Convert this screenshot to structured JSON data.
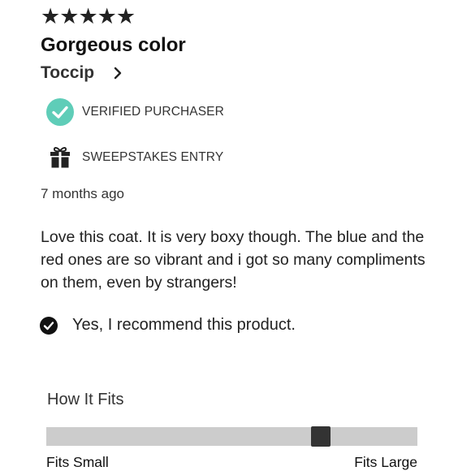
{
  "review": {
    "rating": 5,
    "rating_max": 5,
    "star_glyph": "★",
    "title": "Gorgeous color",
    "author": "Toccip",
    "badges": {
      "verified": {
        "label": "VERIFIED PURCHASER",
        "icon": "check-circle-icon",
        "color": "#5fcdb8"
      },
      "sweepstakes": {
        "label": "SWEEPSTAKES ENTRY",
        "icon": "gift-icon"
      }
    },
    "timestamp": "7 months ago",
    "body": "Love this coat. It is very boxy though. The blue and the red ones are so vibrant and i got so many compliments on them, even by strangers!",
    "recommend": {
      "text": "Yes, I recommend this product.",
      "icon": "check-circle-filled-icon"
    }
  },
  "fit": {
    "title": "How It Fits",
    "min_label": "Fits Small",
    "max_label": "Fits Large",
    "value": 0.74
  }
}
